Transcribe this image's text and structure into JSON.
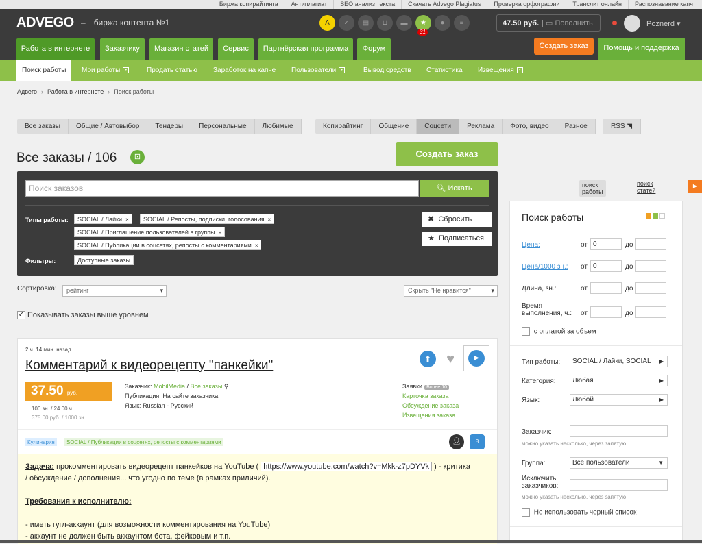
{
  "top_links": [
    "Биржа копирайтинга",
    "Антиплагиат",
    "SEO анализ текста",
    "Скачать Advego Plagiatus",
    "Проверка орфографии",
    "Транслит онлайн",
    "Распознавание капч"
  ],
  "header": {
    "logo": "ADVEGO",
    "dash": "–",
    "tagline": "биржа контента №1",
    "balance": "47.50 руб.",
    "topup": "Пополнить",
    "username": "Poznerd",
    "badge": "31"
  },
  "main_nav": {
    "tabs": [
      "Работа в интернете",
      "Заказчику",
      "Магазин статей",
      "Сервис",
      "Партнёрская программа",
      "Форум"
    ],
    "create_order": "Создать заказ",
    "help": "Помощь и поддержка"
  },
  "sub_nav": {
    "items": [
      "Поиск работы",
      "Мои работы",
      "Продать статью",
      "Заработок на капче",
      "Пользователи",
      "Вывод средств",
      "Статистика",
      "Извещения"
    ]
  },
  "breadcrumb": {
    "items": [
      "Адвего",
      "Работа в интернете",
      "Поиск работы"
    ]
  },
  "filter_bar_1": [
    "Все заказы",
    "Общие / Автовыбор",
    "Тендеры",
    "Персональные",
    "Любимые"
  ],
  "filter_bar_2": [
    "Копирайтинг",
    "Общение",
    "Соцсети",
    "Реклама",
    "Фото, видео",
    "Разное"
  ],
  "rss": "RSS",
  "page": {
    "title": "Все заказы / 106",
    "create_button": "Создать заказ"
  },
  "search": {
    "placeholder": "Поиск заказов",
    "button": "Искать",
    "types_label": "Типы работы:",
    "filters_label": "Фильтры:",
    "tags": [
      "SOCIAL / Лайки",
      "SOCIAL / Репосты, подписки, голосования",
      "SOCIAL / Приглашение пользователей в группы",
      "SOCIAL / Публикации в соцсетях, репосты с комментариями"
    ],
    "filter_tag": "Доступные заказы",
    "reset": "Сбросить",
    "subscribe": "Подписаться"
  },
  "sort": {
    "label": "Сортировка:",
    "value": "рейтинг",
    "hide": "Скрыть \"Не нравится\""
  },
  "show_above": "Показывать заказы выше уровнем",
  "card": {
    "time": "2 ч. 14 мин. назад",
    "title": "Комментарий к видеорецепту \"панкейки\"",
    "price": "37.50",
    "price_unit": "руб.",
    "price_sub1": "100 зн. / 24.00 ч.",
    "price_sub2": "375.00 руб. / 1000 зн.",
    "customer_label": "Заказчик:",
    "customer": "MobilMedia",
    "all_orders": "Все заказы",
    "pub_label": "Публикация:",
    "pub": "На сайте заказчика",
    "lang_label": "Язык:",
    "lang": "Russian - Русский",
    "links": [
      "Заявки",
      "Карточка заказа",
      "Обсуждение заказа",
      "Извещения заказа"
    ],
    "more": "Более 10",
    "tag1": "Кулинария",
    "tag2": "SOCIAL / Публикации в соцсетях, репосты с комментариями",
    "badge": "8",
    "task_label": "Задача:",
    "task_text": "прокомментировать видеорецепт панкейков на YouTube (",
    "url": "https://www.youtube.com/watch?v=Mkk-z7pDYVk",
    "task_text2": ") - критика",
    "task_text3": "/ обсуждение / дополнения... что угодно по теме (в рамках приличий).",
    "req_label": "Требования к исполнителю:",
    "req1": "- иметь гугл-аккаунт (для возможности комментирования на YouTube)",
    "req2": "- аккаунт не должен быть аккаунтом бота, фейковым и т.п."
  },
  "right_links": {
    "a": "поиск работы",
    "b": "поиск статей"
  },
  "sidebar": {
    "title": "Поиск работы",
    "price": "Цена:",
    "price1000": "Цена/1000 зн.:",
    "length": "Длина, зн.:",
    "time1": "Время",
    "time2": "выполнения, ч.:",
    "from": "от",
    "to": "до",
    "v0": "0",
    "volume": "с оплатой за объем",
    "type_label": "Тип работы:",
    "type_val": "SOCIAL / Лайки, SOCIAL",
    "cat_label": "Категория:",
    "cat_val": "Любая",
    "lang_label": "Язык:",
    "lang_val": "Любой",
    "cust_label": "Заказчик:",
    "hint": "можно указать несколько, через запятую",
    "group_label": "Группа:",
    "group_val": "Все пользователи",
    "excl1": "Исключить",
    "excl2": "заказчиков:",
    "blacklist": "Не использовать черный список"
  }
}
